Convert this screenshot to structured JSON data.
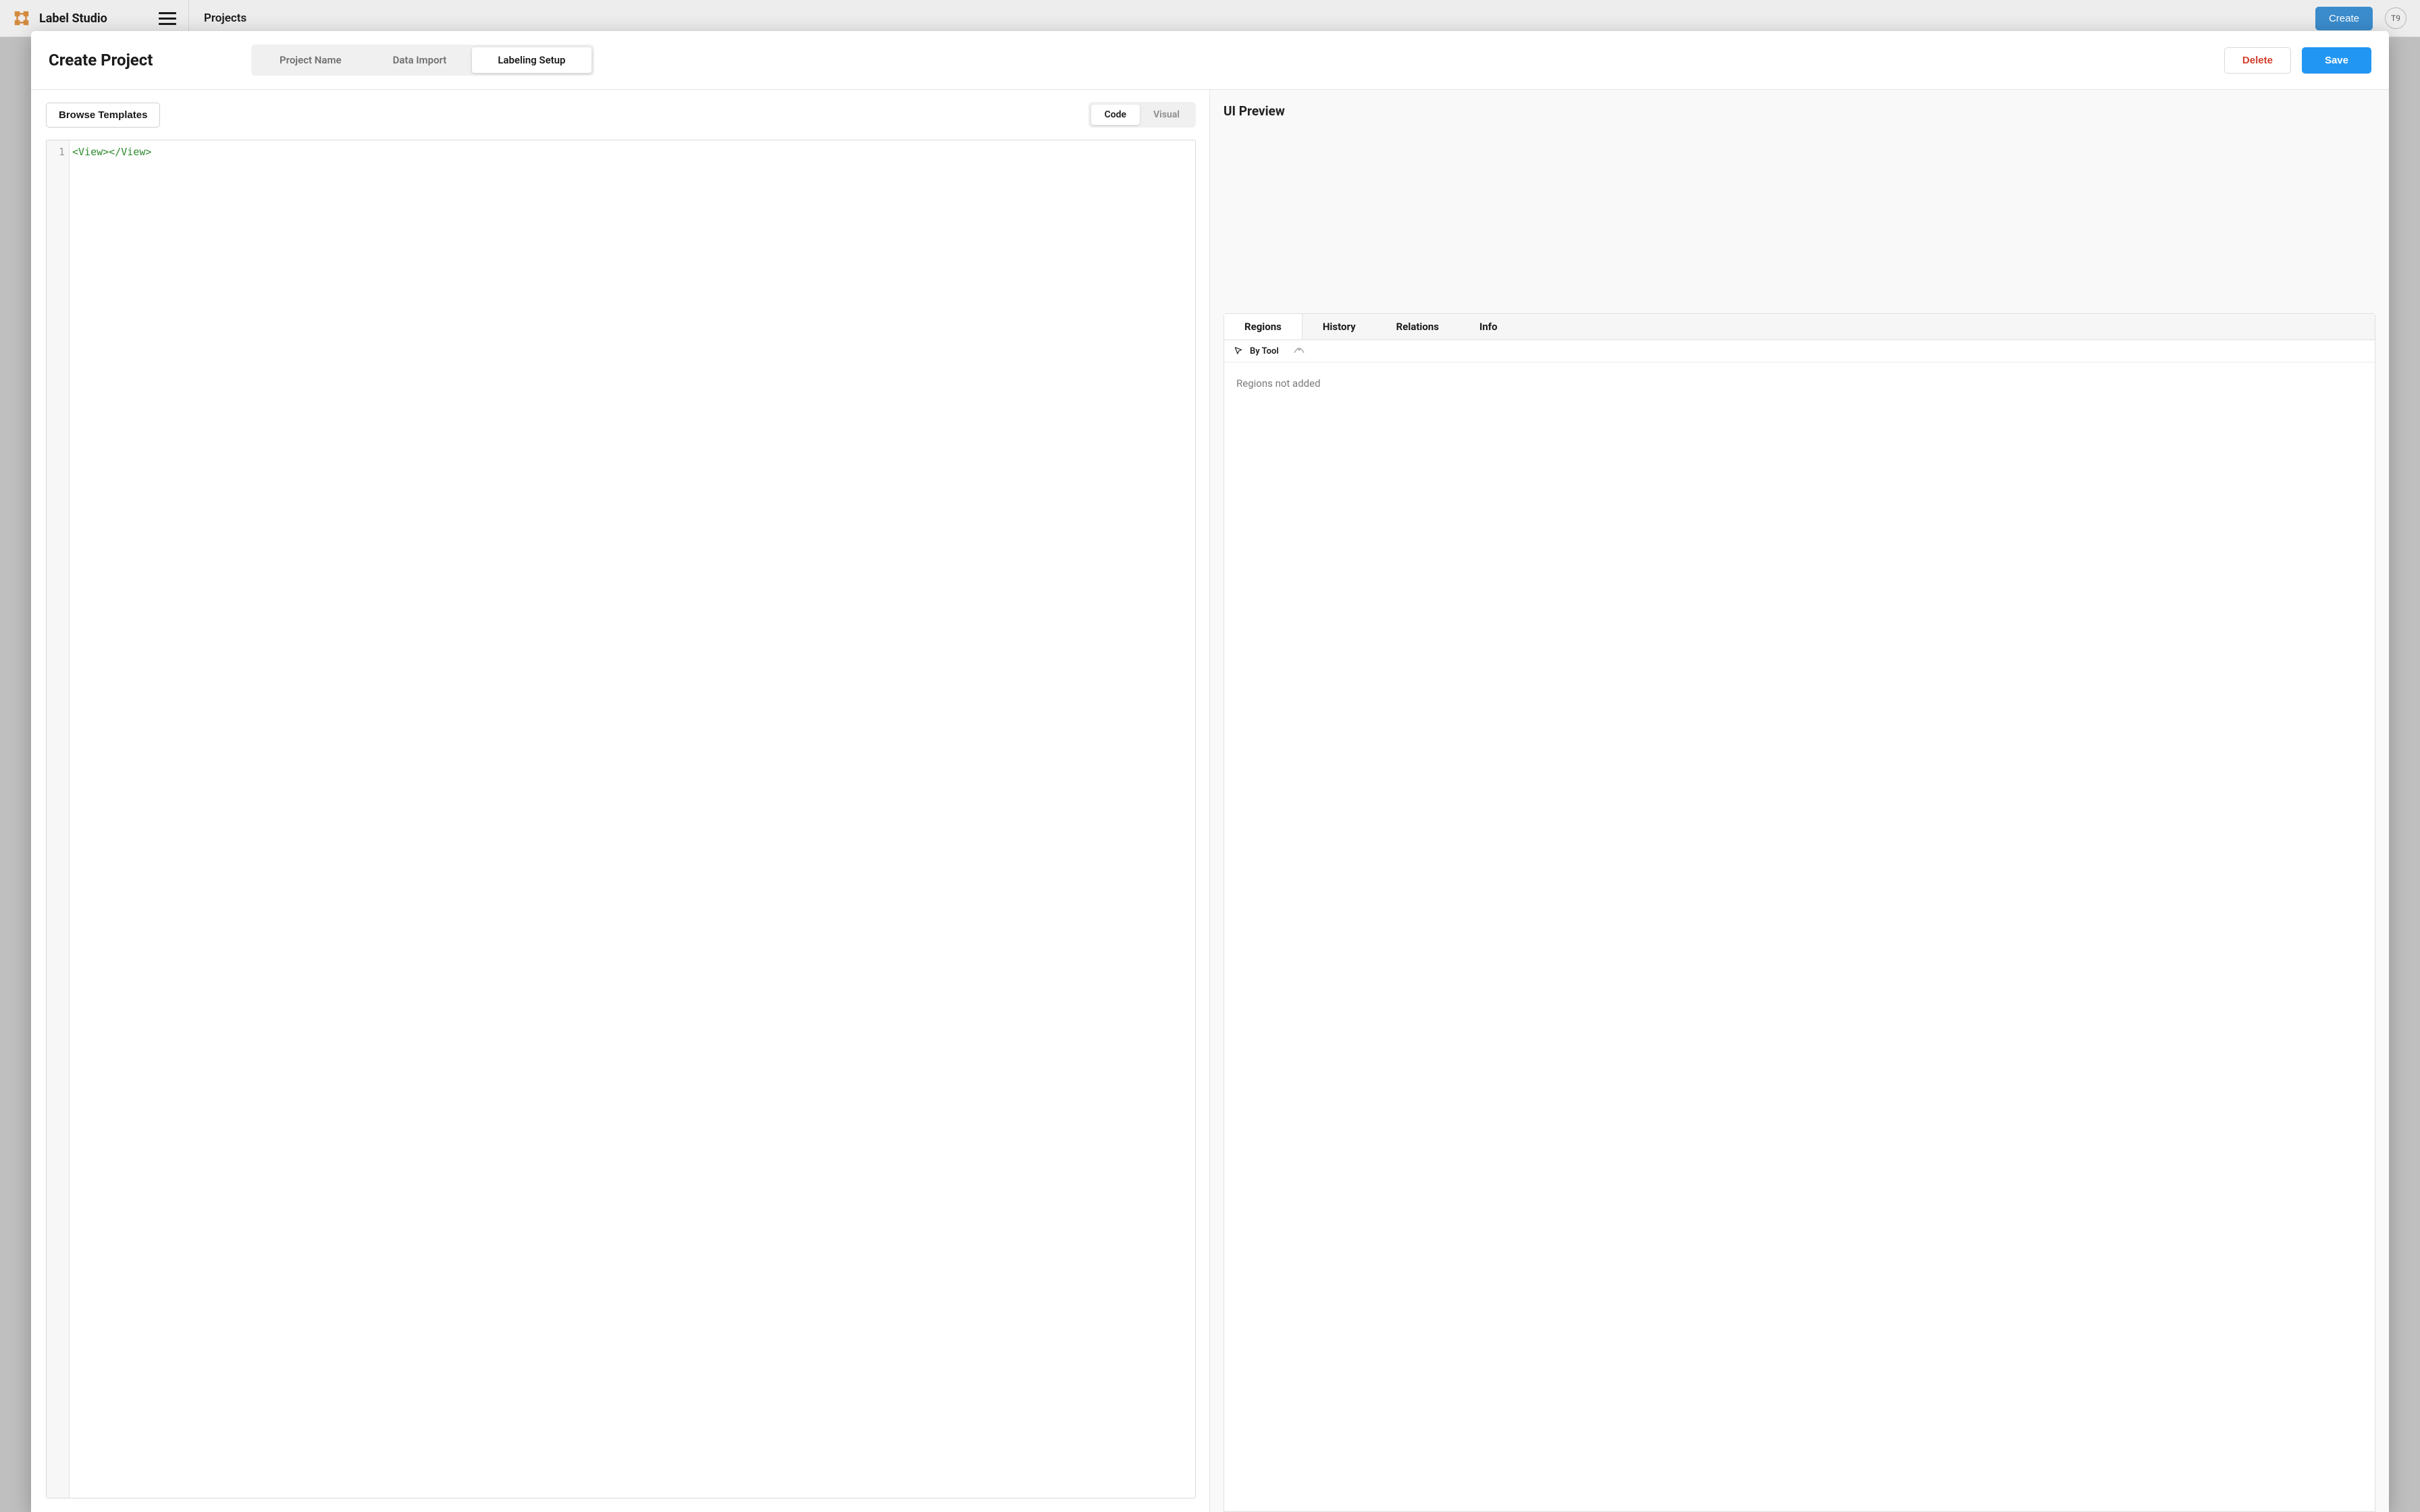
{
  "app": {
    "title": "Label Studio"
  },
  "breadcrumb": "Projects",
  "header": {
    "create_label": "Create",
    "avatar": "T9"
  },
  "modal": {
    "title": "Create Project",
    "steps": [
      {
        "label": "Project Name",
        "active": false
      },
      {
        "label": "Data Import",
        "active": false
      },
      {
        "label": "Labeling Setup",
        "active": true
      }
    ],
    "delete_label": "Delete",
    "save_label": "Save"
  },
  "left_panel": {
    "browse_label": "Browse Templates",
    "view_toggle": [
      {
        "label": "Code",
        "active": true
      },
      {
        "label": "Visual",
        "active": false
      }
    ],
    "editor": {
      "line_number": "1",
      "content": "<View></View>"
    }
  },
  "right_panel": {
    "title": "UI Preview",
    "tabs": [
      {
        "label": "Regions",
        "active": true
      },
      {
        "label": "History",
        "active": false
      },
      {
        "label": "Relations",
        "active": false
      },
      {
        "label": "Info",
        "active": false
      }
    ],
    "sort_label": "By Tool",
    "empty_message": "Regions not added"
  }
}
